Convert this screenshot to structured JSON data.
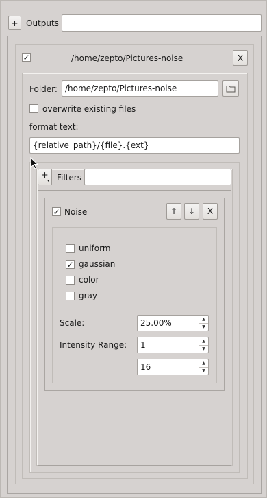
{
  "outputs": {
    "add_label": "+",
    "label": "Outputs",
    "field_value": ""
  },
  "output_panel": {
    "enabled_check": "✓",
    "title": "/home/zepto/Pictures-noise",
    "close_label": "X",
    "folder_label": "Folder:",
    "folder_value": "/home/zepto/Pictures-noise",
    "overwrite_label": "overwrite existing files",
    "overwrite_check": "",
    "format_label": "format text:",
    "format_value": "{relative_path}/{file}.{ext}"
  },
  "filters": {
    "add_label": "+",
    "label": "Filters",
    "field_value": ""
  },
  "noise_filter": {
    "enabled_check": "✓",
    "title": "Noise",
    "up_label": "↑",
    "down_label": "↓",
    "close_label": "X",
    "options": [
      {
        "label": "uniform",
        "check": ""
      },
      {
        "label": "gaussian",
        "check": "✓"
      },
      {
        "label": "color",
        "check": ""
      },
      {
        "label": "gray",
        "check": ""
      }
    ],
    "scale_label": "Scale:",
    "scale_value": "25.00%",
    "intensity_label": "Intensity Range:",
    "intensity_min": "1",
    "intensity_max": "16"
  }
}
